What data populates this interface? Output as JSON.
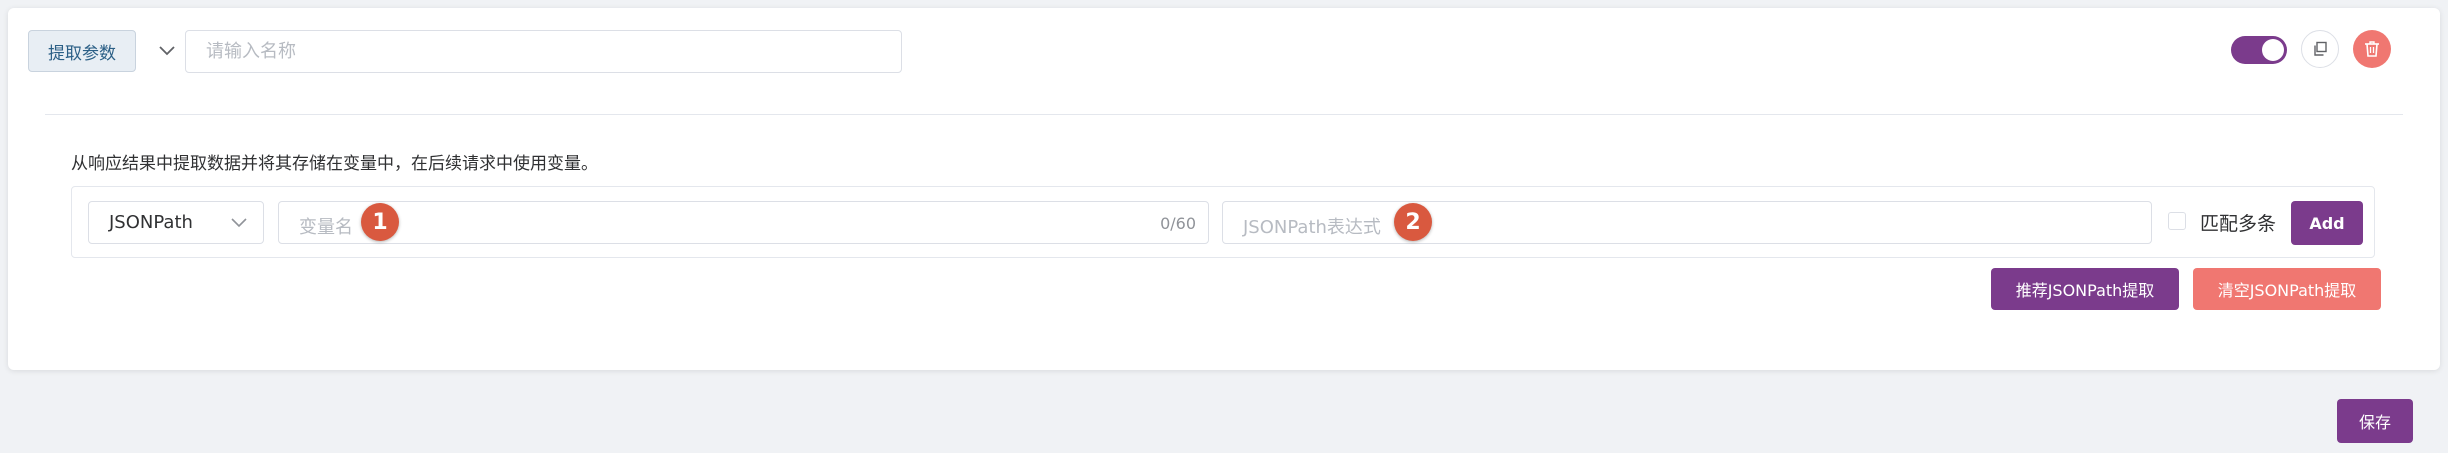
{
  "header": {
    "tag_label": "提取参数",
    "name_placeholder": "请输入名称",
    "name_value": ""
  },
  "controls": {
    "toggle_enabled": true,
    "copy_icon": "copy-icon",
    "delete_icon": "trash-icon"
  },
  "description": "从响应结果中提取数据并将其存储在变量中，在后续请求中使用变量。",
  "rule": {
    "type_selected": "JSONPath",
    "variable_placeholder": "变量名",
    "variable_counter": "0/60",
    "variable_badge": "1",
    "expression_placeholder": "JSONPath表达式",
    "expression_badge": "2",
    "match_multiple_label": "匹配多条",
    "match_multiple_checked": false,
    "add_label": "Add"
  },
  "actions": {
    "recommend_label": "推荐JSONPath提取",
    "clear_label": "清空JSONPath提取"
  },
  "footer": {
    "save_label": "保存"
  },
  "colors": {
    "primary": "#7b3b8c",
    "danger": "#f07771",
    "badge": "#d9593f"
  }
}
